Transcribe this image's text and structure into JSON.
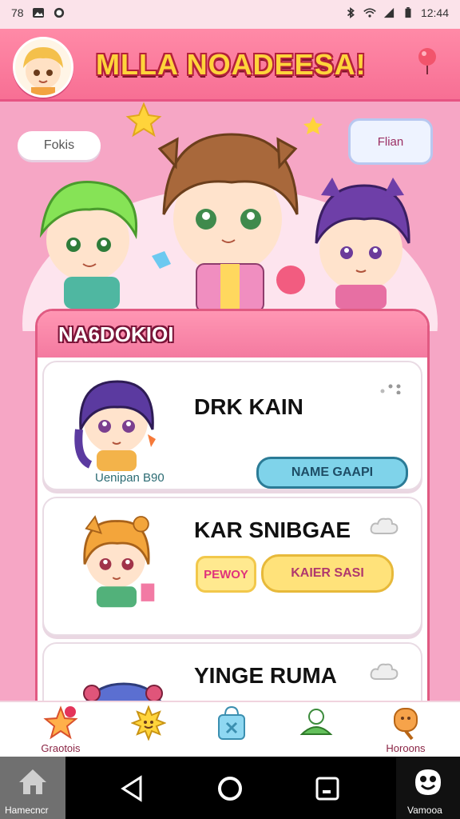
{
  "status_bar": {
    "left_text": "78",
    "time": "12:44"
  },
  "header": {
    "title": "MLLA NOADEESA!"
  },
  "hero": {
    "cloud_left_text": "Fokis",
    "cloud_right_text": "Flian"
  },
  "panel": {
    "title": "NA6DOKIOI",
    "cards": [
      {
        "name": "DRK KAIN",
        "subtitle": "Uenipan B90",
        "button_label": "NAME GAAPI"
      },
      {
        "name": "KAR SNIBGAE",
        "badge_label": "PEWOY",
        "button_label": "KAIER SASI"
      },
      {
        "name": "YINGE RUMA"
      }
    ]
  },
  "tabbar": {
    "items": [
      {
        "label": "Graotois",
        "icon": "star-icon"
      },
      {
        "label": "",
        "icon": "sun-icon"
      },
      {
        "label": "",
        "icon": "bag-icon"
      },
      {
        "label": "",
        "icon": "bell-icon"
      },
      {
        "label": "Horoons",
        "icon": "lollipop-icon"
      }
    ]
  },
  "android_nav": {
    "left_label": "Hamecncr",
    "right_label": "Vamooa"
  },
  "colors": {
    "header_pink": "#f76f94",
    "title_yellow": "#ffd43b",
    "panel_border": "#e15a82",
    "cyan_button": "#7fd3ea",
    "yellow_button": "#ffe27a"
  }
}
